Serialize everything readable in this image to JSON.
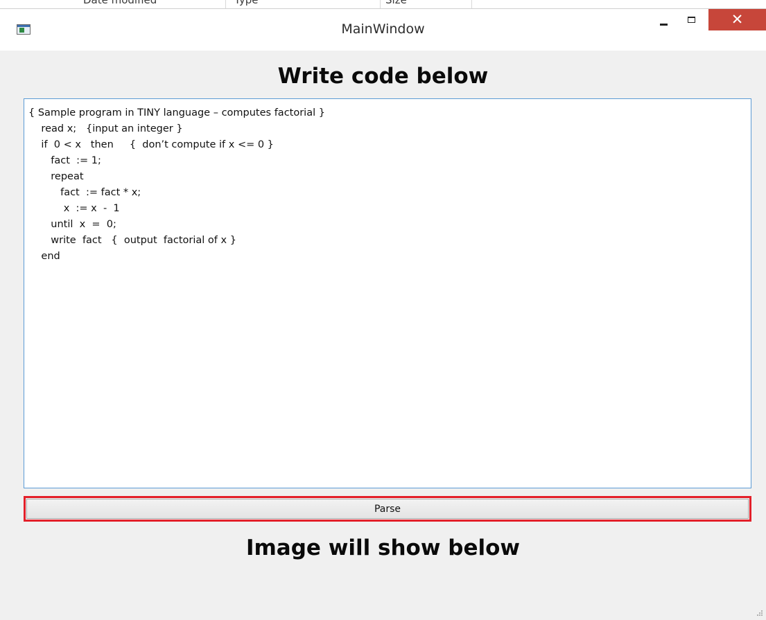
{
  "background_window": {
    "columns": [
      "Date modified",
      "Type",
      "Size"
    ]
  },
  "window": {
    "title": "MainWindow",
    "icon": "app-window-icon",
    "close_glyph": "✕",
    "colors": {
      "close_button": "#c7463a",
      "editor_border": "#5b9bd5",
      "parse_highlight": "#e3202a",
      "window_bg": "#f0f0f0"
    }
  },
  "main": {
    "heading_top": "Write code below",
    "code_lines": [
      "{ Sample program in TINY language – computes factorial }",
      "    read x;   {input an integer }",
      "    if  0 < x   then     {  don’t compute if x <= 0 }",
      "       fact  := 1;",
      "       repeat",
      "          fact  := fact * x;",
      "           x  := x  -  1",
      "       until  x  =  0;",
      "       write  fact   {  output  factorial of x }",
      "    end"
    ],
    "parse_label": "Parse",
    "heading_bottom": "Image will show below"
  }
}
